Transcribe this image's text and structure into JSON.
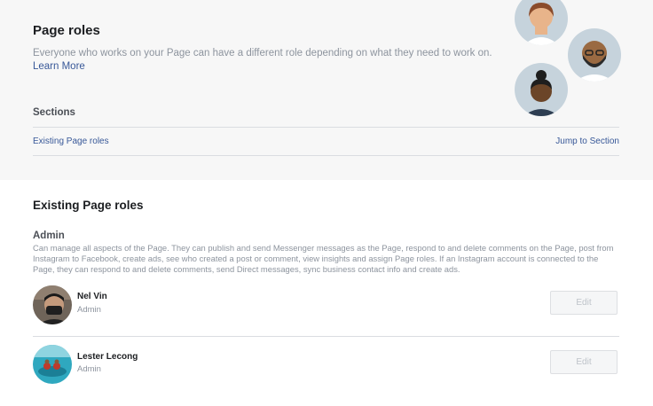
{
  "header": {
    "title": "Page roles",
    "description": "Everyone who works on your Page can have a different role depending on what they need to work on.",
    "learn_more": "Learn More",
    "sections_label": "Sections",
    "section_link": "Existing Page roles",
    "jump_to_section": "Jump to Section"
  },
  "existing": {
    "heading": "Existing Page roles",
    "role_title": "Admin",
    "role_description": "Can manage all aspects of the Page. They can publish and send Messenger messages as the Page, respond to and delete comments on the Page, post from Instagram to Facebook, create ads, see who created a post or comment, view insights and assign Page roles. If an Instagram account is connected to the Page, they can respond to and delete comments, send Direct messages, sync business contact info and create ads.",
    "people": [
      {
        "name": "Nel Vin",
        "role": "Admin",
        "edit_label": "Edit"
      },
      {
        "name": "Lester Lecong",
        "role": "Admin",
        "edit_label": "Edit"
      }
    ]
  },
  "colors": {
    "link": "#385898",
    "muted_text": "#8d949e",
    "header_background": "#f7f7f7",
    "illustration_circle": "#c6d3dc"
  },
  "icons": [
    "person-illustration-woman",
    "person-illustration-bearded-man",
    "person-illustration-woman-bun"
  ]
}
